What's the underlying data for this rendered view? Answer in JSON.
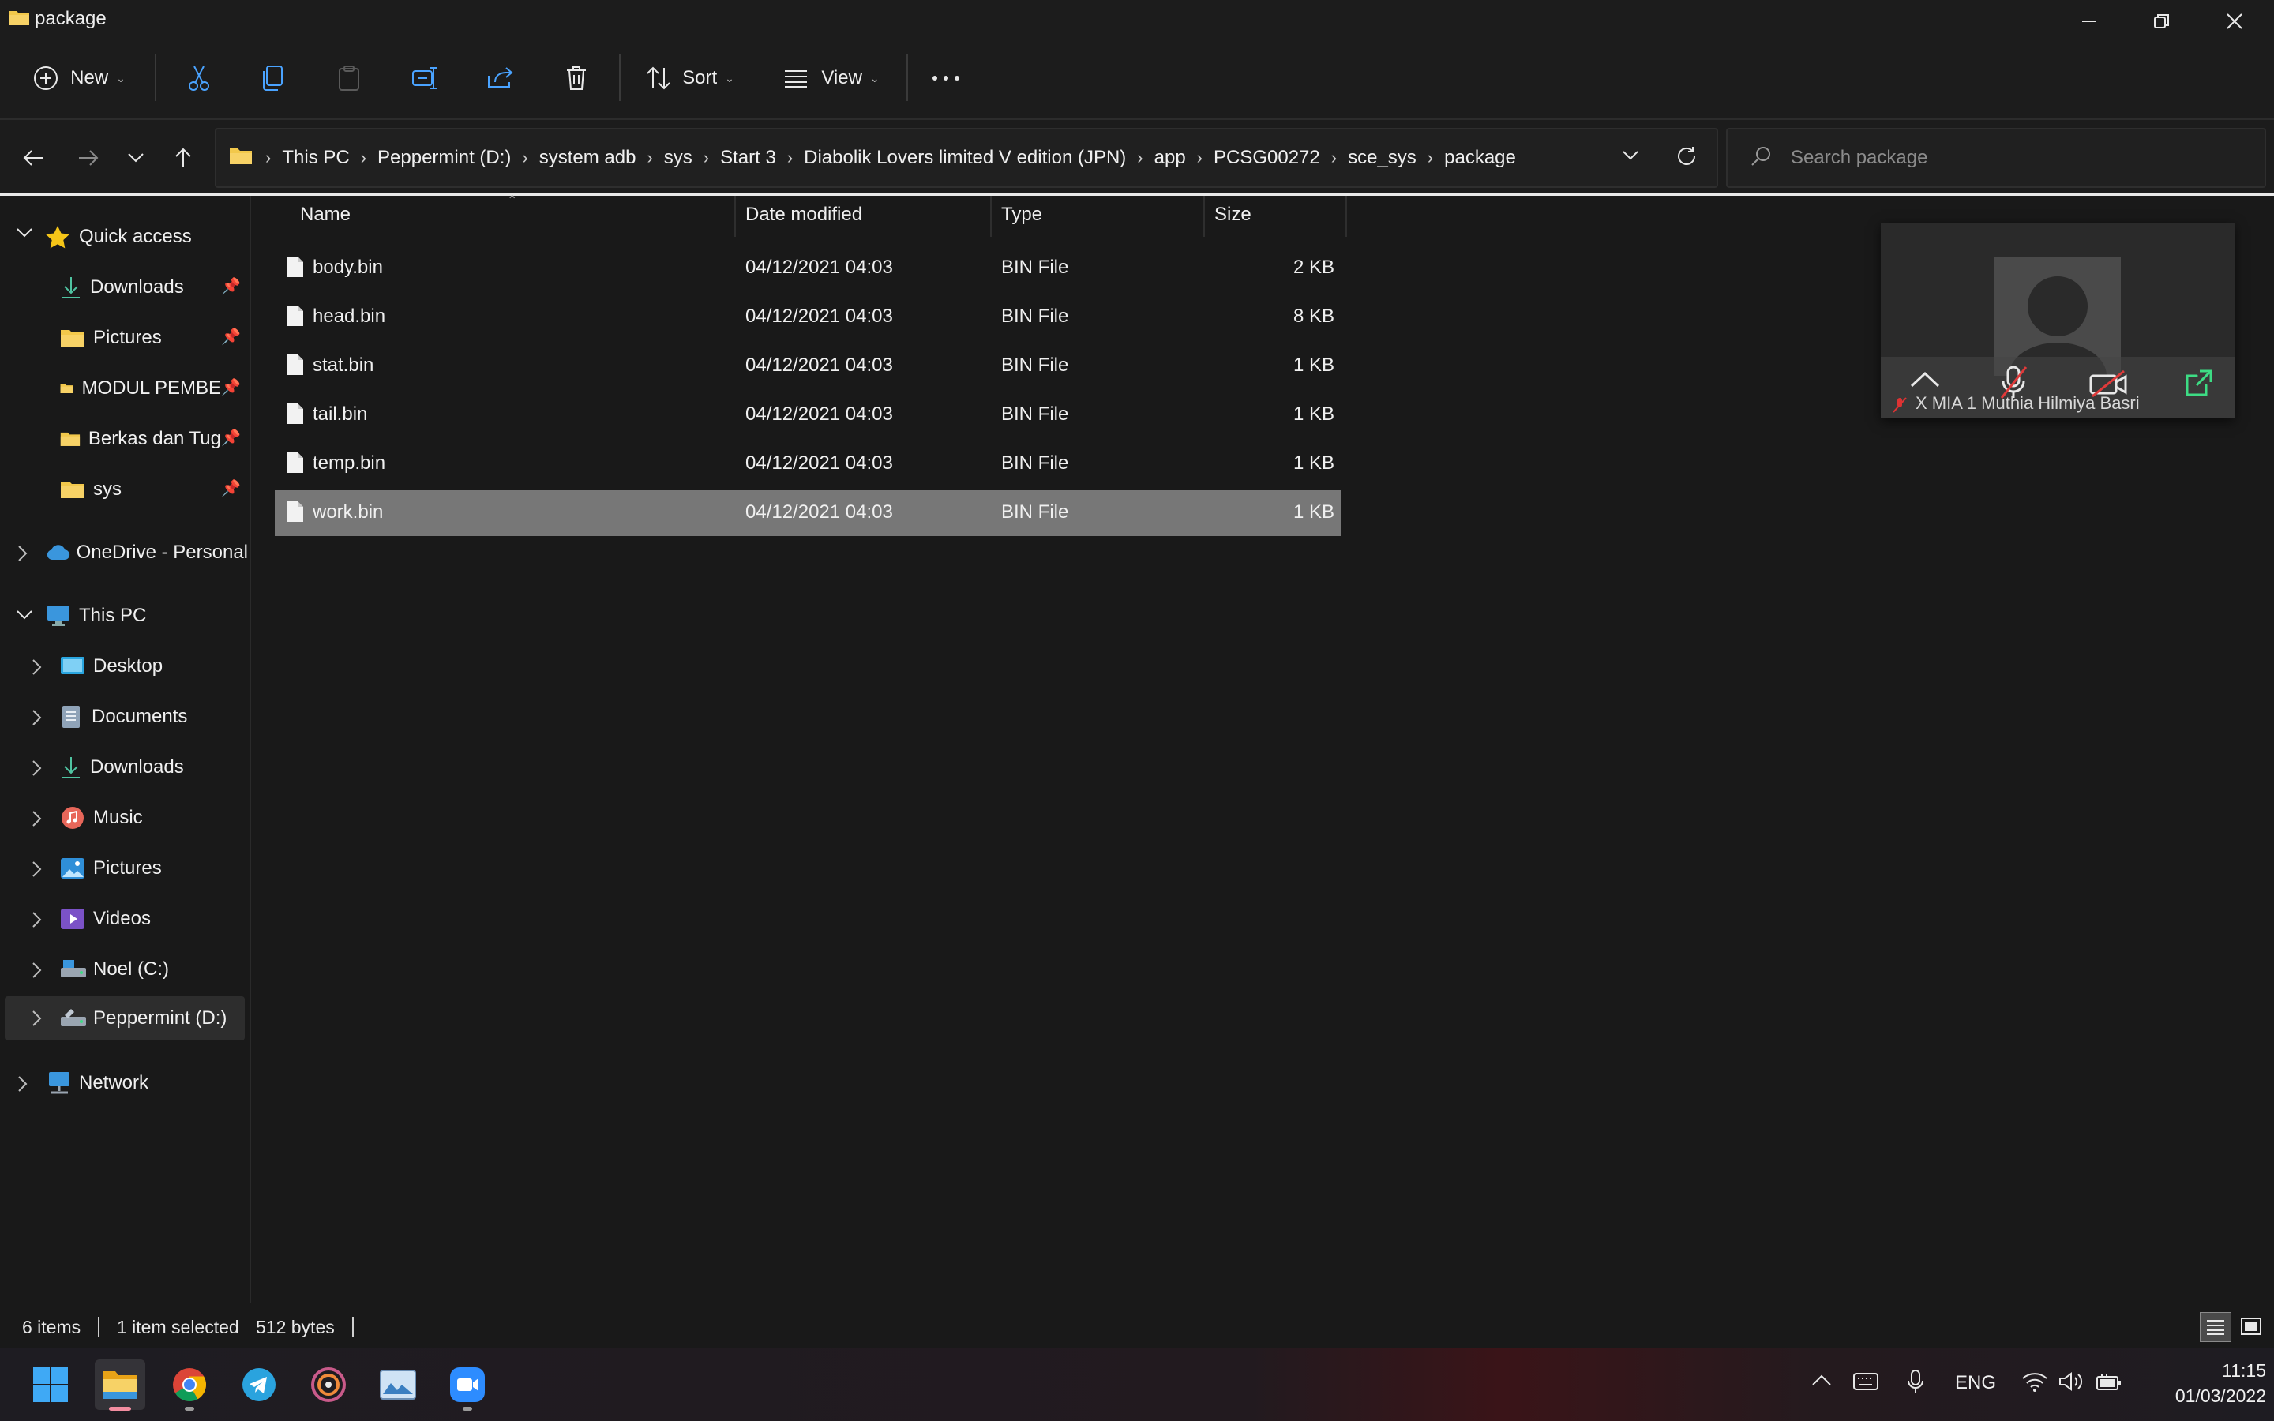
{
  "window": {
    "title": "package"
  },
  "toolbar": {
    "new_label": "New",
    "sort_label": "Sort",
    "view_label": "View"
  },
  "breadcrumb": [
    "This PC",
    "Peppermint (D:)",
    "system adb",
    "sys",
    "Start 3",
    "Diabolik Lovers limited V edition (JPN)",
    "app",
    "PCSG00272",
    "sce_sys",
    "package"
  ],
  "search": {
    "placeholder": "Search package"
  },
  "sidebar": {
    "quick_access": "Quick access",
    "quick_items": [
      {
        "label": "Downloads",
        "icon": "download-icon",
        "pinned": true
      },
      {
        "label": "Pictures",
        "icon": "folder-icon",
        "pinned": true
      },
      {
        "label": "MODUL PEMBE",
        "icon": "folder-icon",
        "pinned": true
      },
      {
        "label": "Berkas dan Tug",
        "icon": "folder-icon",
        "pinned": true
      },
      {
        "label": "sys",
        "icon": "folder-icon",
        "pinned": true
      }
    ],
    "onedrive": "OneDrive - Personal",
    "this_pc": "This PC",
    "pc_items": [
      {
        "label": "Desktop",
        "icon": "desktop-icon"
      },
      {
        "label": "Documents",
        "icon": "documents-icon"
      },
      {
        "label": "Downloads",
        "icon": "download-icon"
      },
      {
        "label": "Music",
        "icon": "music-icon"
      },
      {
        "label": "Pictures",
        "icon": "pictures-icon"
      },
      {
        "label": "Videos",
        "icon": "videos-icon"
      },
      {
        "label": "Noel (C:)",
        "icon": "drive-icon"
      },
      {
        "label": "Peppermint (D:)",
        "icon": "drive-icon"
      }
    ],
    "network": "Network"
  },
  "columns": {
    "name": "Name",
    "date": "Date modified",
    "type": "Type",
    "size": "Size"
  },
  "files": [
    {
      "name": "body.bin",
      "date": "04/12/2021 04:03",
      "type": "BIN File",
      "size": "2 KB",
      "selected": false
    },
    {
      "name": "head.bin",
      "date": "04/12/2021 04:03",
      "type": "BIN File",
      "size": "8 KB",
      "selected": false
    },
    {
      "name": "stat.bin",
      "date": "04/12/2021 04:03",
      "type": "BIN File",
      "size": "1 KB",
      "selected": false
    },
    {
      "name": "tail.bin",
      "date": "04/12/2021 04:03",
      "type": "BIN File",
      "size": "1 KB",
      "selected": false
    },
    {
      "name": "temp.bin",
      "date": "04/12/2021 04:03",
      "type": "BIN File",
      "size": "1 KB",
      "selected": false
    },
    {
      "name": "work.bin",
      "date": "04/12/2021 04:03",
      "type": "BIN File",
      "size": "1 KB",
      "selected": true
    }
  ],
  "video": {
    "participant": "X MIA 1 Muthia Hilmiya Basri"
  },
  "status": {
    "count": "6 items",
    "selection": "1 item selected",
    "bytes": "512 bytes"
  },
  "tray": {
    "language": "ENG",
    "time": "11:15",
    "date": "01/03/2022"
  },
  "colors": {
    "background": "#191919",
    "selected_row": "#777777",
    "folder": "#f2c84b",
    "accent": "#4aa3ff"
  }
}
